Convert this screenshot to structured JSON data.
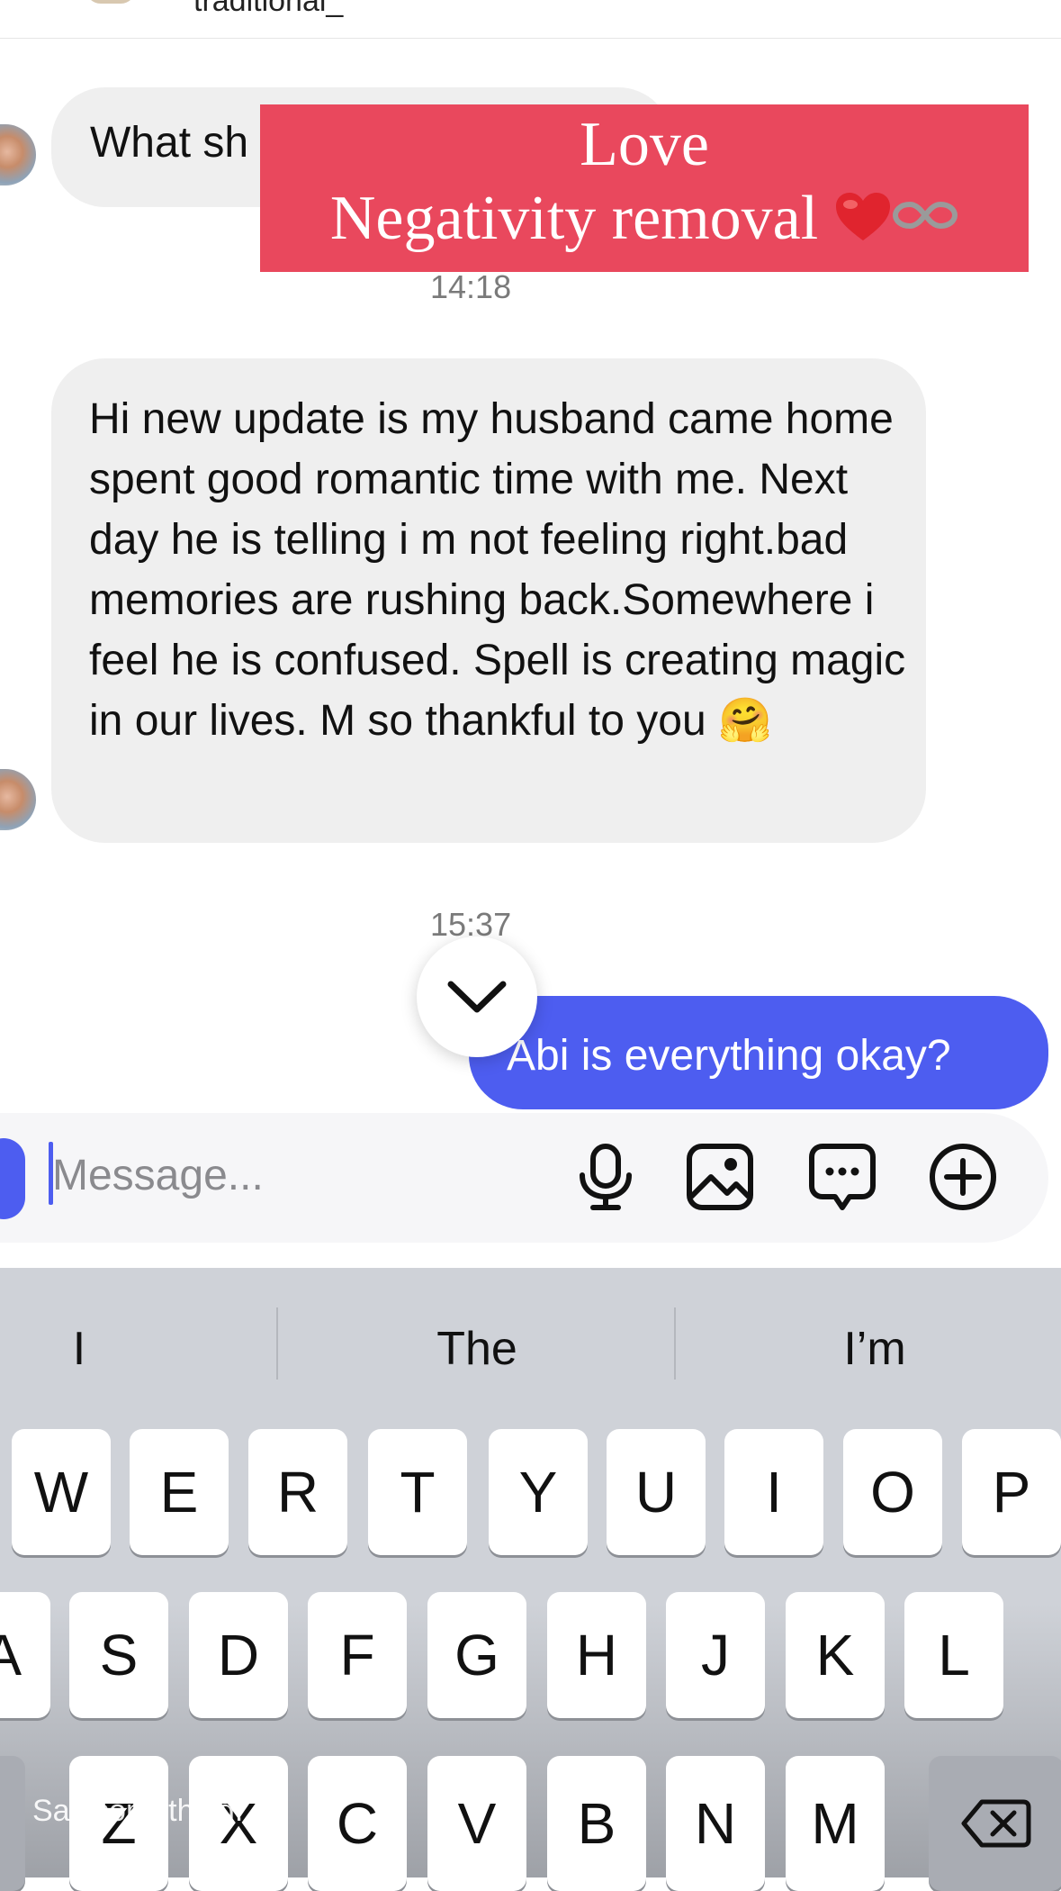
{
  "header": {
    "username": "traditional_"
  },
  "messages": {
    "incoming_1": "What sh",
    "timestamp_1": "14:18",
    "incoming_2": "Hi new update is my husband came home spent good romantic time with me. Next day he is telling i m not feeling right.bad memories are rushing back.Somewhere i feel he is confused. Spell is creating magic in our lives. M so thankful to you 🤗",
    "timestamp_2": "15:37",
    "outgoing_1": "Abi is everything okay?"
  },
  "promo": {
    "line1": "Love",
    "line2": "Negativity removal",
    "accent": "#e9485d"
  },
  "composer": {
    "placeholder": "Message...",
    "icons": [
      "microphone-icon",
      "gallery-icon",
      "sticker-icon",
      "plus-icon"
    ]
  },
  "keyboard": {
    "suggestions": [
      "I",
      "The",
      "I’m"
    ],
    "row1": [
      "W",
      "E",
      "R",
      "T",
      "Y",
      "U",
      "I",
      "O",
      "P"
    ],
    "row2": [
      "A",
      "S",
      "D",
      "F",
      "G",
      "H",
      "J",
      "K",
      "L"
    ],
    "row3": [
      "Z",
      "X",
      "C",
      "V",
      "B",
      "N",
      "M"
    ]
  },
  "overlay": {
    "say_something": "Say something..."
  },
  "colors": {
    "outgoing_bubble": "#4d5df0",
    "incoming_bubble": "#efefef"
  }
}
